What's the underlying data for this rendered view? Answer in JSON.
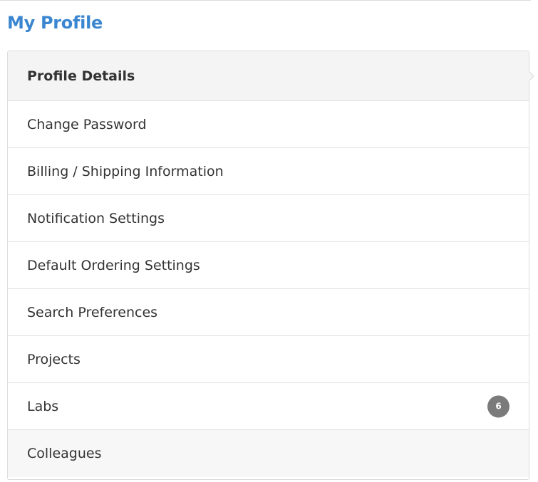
{
  "header": {
    "title": "My Profile"
  },
  "menu": {
    "items": [
      {
        "label": "Profile Details"
      },
      {
        "label": "Change Password"
      },
      {
        "label": "Billing / Shipping Information"
      },
      {
        "label": "Notification Settings"
      },
      {
        "label": "Default Ordering Settings"
      },
      {
        "label": "Search Preferences"
      },
      {
        "label": "Projects"
      },
      {
        "label": "Labs",
        "badge": "6"
      },
      {
        "label": "Colleagues"
      }
    ],
    "active_index": 0
  },
  "colors": {
    "title": "#3a86d0",
    "active_background": "#f4f4f4",
    "badge_background": "#7b7b7b",
    "border": "#dddddd"
  }
}
